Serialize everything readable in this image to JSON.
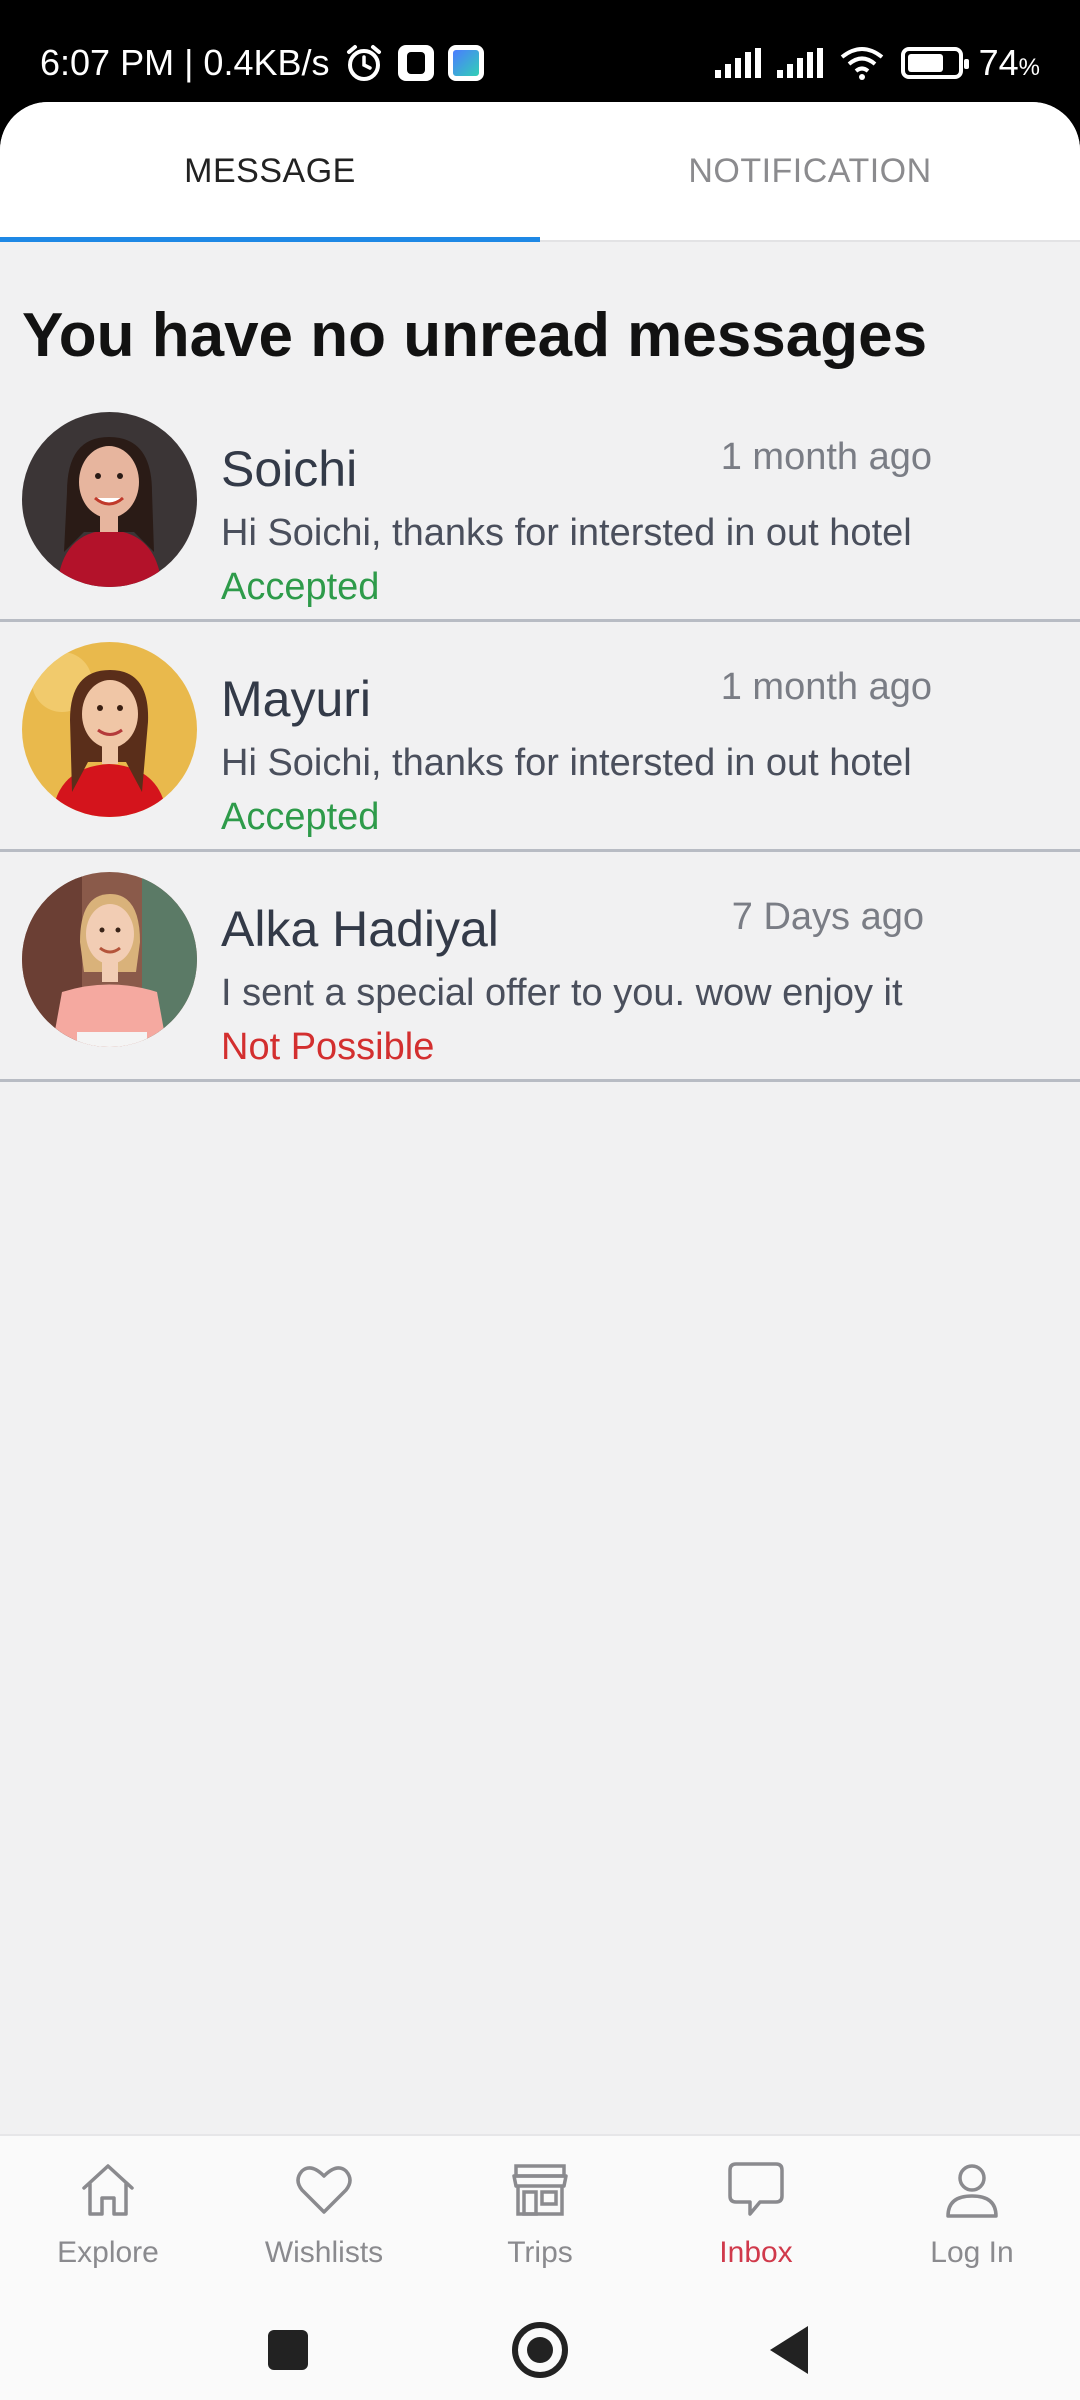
{
  "status_bar": {
    "time_speed": "6:07 PM | 0.4KB/s",
    "battery": "74",
    "battery_unit": "%",
    "battery_level": 0.74
  },
  "tabs": [
    {
      "label": "MESSAGE",
      "active": true
    },
    {
      "label": "NOTIFICATION",
      "active": false
    }
  ],
  "heading": "You have no unread messages",
  "messages": [
    {
      "name": "Soichi",
      "time": "1 month ago",
      "text": "Hi Soichi, thanks for intersted in out hotel",
      "status": "Accepted",
      "status_color": "#2e9b4a"
    },
    {
      "name": "Mayuri",
      "time": "1 month ago",
      "text": "Hi Soichi, thanks for intersted in out hotel",
      "status": "Accepted",
      "status_color": "#2e9b4a"
    },
    {
      "name": "Alka Hadiyal",
      "time": "7 Days ago",
      "text": "I sent a special offer to you. wow enjoy it",
      "status": "Not Possible",
      "status_color": "#d32f2f"
    }
  ],
  "bottom_nav": [
    {
      "label": "Explore",
      "icon": "home-icon",
      "active": false
    },
    {
      "label": "Wishlists",
      "icon": "heart-icon",
      "active": false
    },
    {
      "label": "Trips",
      "icon": "store-icon",
      "active": false
    },
    {
      "label": "Inbox",
      "icon": "chat-icon",
      "active": true
    },
    {
      "label": "Log In",
      "icon": "user-icon",
      "active": false
    }
  ],
  "colors": {
    "tab_indicator": "#1e88e5",
    "nav_active": "#d0394b",
    "background": "#f1f1f2"
  }
}
